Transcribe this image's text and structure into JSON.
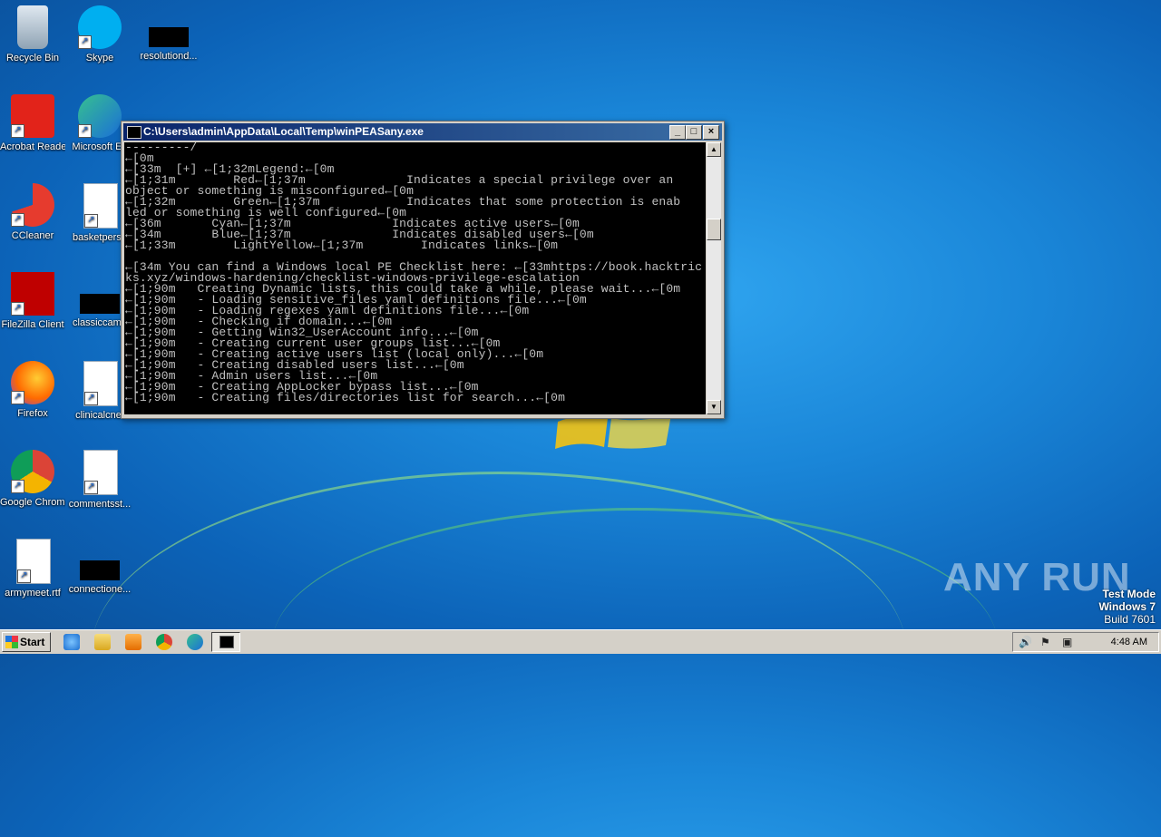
{
  "desktop": {
    "icons": [
      {
        "label": "Recycle Bin",
        "icon": "recycle-bin-icon"
      },
      {
        "label": "Skype",
        "icon": "skype-icon"
      },
      {
        "label": "resolutiond...",
        "icon": "blank-file-icon"
      },
      {
        "label": "Acrobat Reader DC",
        "icon": "acrobat-icon"
      },
      {
        "label": "Microsoft Ed",
        "icon": "edge-icon"
      },
      {
        "label": "CCleaner",
        "icon": "ccleaner-icon"
      },
      {
        "label": "basketperso",
        "icon": "word-doc-icon"
      },
      {
        "label": "FileZilla Client",
        "icon": "filezilla-icon"
      },
      {
        "label": "classiccame",
        "icon": "blank-file-icon"
      },
      {
        "label": "Firefox",
        "icon": "firefox-icon"
      },
      {
        "label": "clinicalcnet",
        "icon": "word-doc-icon"
      },
      {
        "label": "Google Chrome",
        "icon": "chrome-icon"
      },
      {
        "label": "commentsst...",
        "icon": "word-doc-icon"
      },
      {
        "label": "armymeet.rtf",
        "icon": "word-doc-icon"
      },
      {
        "label": "connectione...",
        "icon": "blank-file-icon"
      }
    ]
  },
  "console": {
    "title": "C:\\Users\\admin\\AppData\\Local\\Temp\\winPEASany.exe",
    "lines": [
      "---------/",
      "←[0m",
      "←[33m  [+] ←[1;32mLegend:←[0m",
      "←[1;31m        Red←[1;37m              Indicates a special privilege over an",
      "object or something is misconfigured←[0m",
      "←[1;32m        Green←[1;37m            Indicates that some protection is enab",
      "led or something is well configured←[0m",
      "←[36m       Cyan←[1;37m              Indicates active users←[0m",
      "←[34m       Blue←[1;37m              Indicates disabled users←[0m",
      "←[1;33m        LightYellow←[1;37m        Indicates links←[0m",
      "",
      "←[34m You can find a Windows local PE Checklist here: ←[33mhttps://book.hacktric",
      "ks.xyz/windows-hardening/checklist-windows-privilege-escalation",
      "←[1;90m   Creating Dynamic lists, this could take a while, please wait...←[0m",
      "←[1;90m   - Loading sensitive_files yaml definitions file...←[0m",
      "←[1;90m   - Loading regexes yaml definitions file...←[0m",
      "←[1;90m   - Checking if domain...←[0m",
      "←[1;90m   - Getting Win32_UserAccount info...←[0m",
      "←[1;90m   - Creating current user groups list...←[0m",
      "←[1;90m   - Creating active users list (local only)...←[0m",
      "←[1;90m   - Creating disabled users list...←[0m",
      "←[1;90m   - Admin users list...←[0m",
      "←[1;90m   - Creating AppLocker bypass list...←[0m",
      "←[1;90m   - Creating files/directories list for search...←[0m"
    ]
  },
  "watermark": "ANY RUN",
  "testmode": {
    "line1": "Test Mode",
    "line2": "Windows 7",
    "line3": "Build 7601"
  },
  "taskbar": {
    "start_label": "Start",
    "clock": "4:48 AM",
    "pinned": [
      "ie-icon",
      "explorer-icon",
      "media-player-icon",
      "chrome-icon",
      "edge-icon",
      "console-icon"
    ]
  }
}
